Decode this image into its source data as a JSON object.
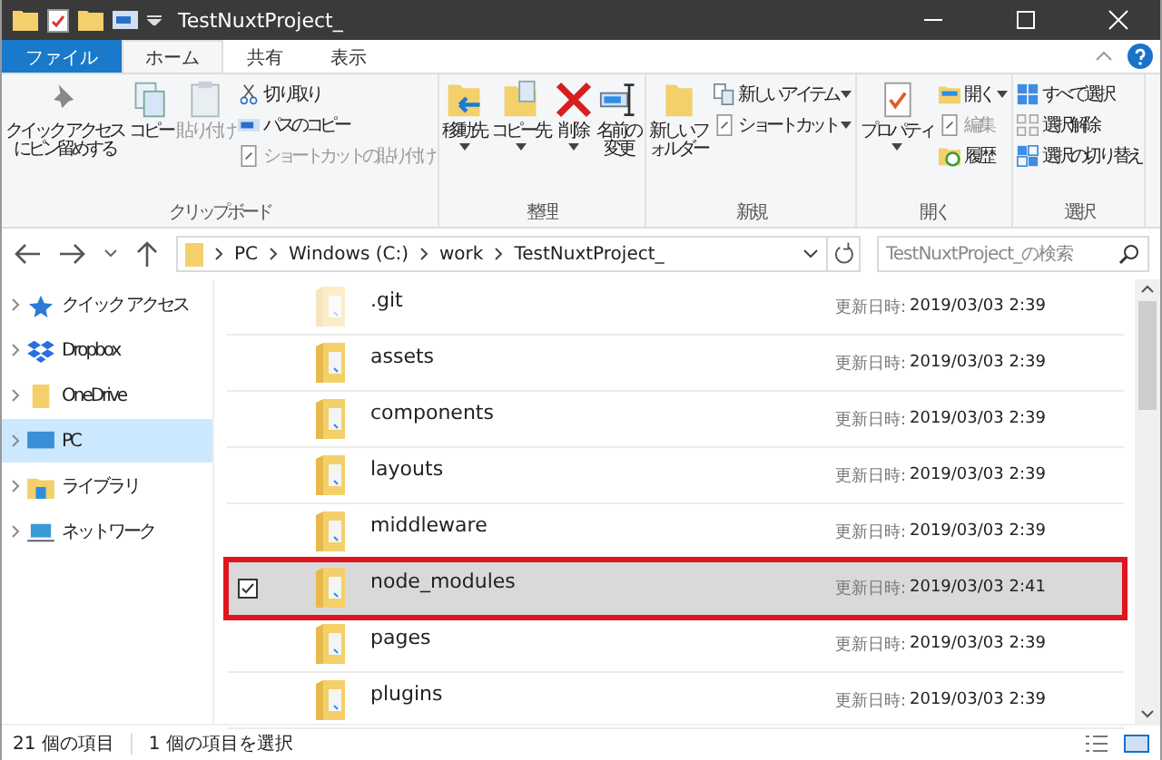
{
  "window": {
    "title": "TestNuxtProject_"
  },
  "tabs": [
    {
      "label": "ファイル",
      "kind": "file",
      "selected": false
    },
    {
      "label": "ホーム",
      "kind": "tab",
      "selected": true
    },
    {
      "label": "共有",
      "kind": "tab",
      "selected": false
    },
    {
      "label": "表示",
      "kind": "tab",
      "selected": false
    }
  ],
  "ribbon": [
    {
      "label": "クリップボード",
      "items": [
        {
          "kind": "large",
          "label": "クイック アクセスにピン留めする",
          "disabled": false
        },
        {
          "kind": "large",
          "label": "コピー",
          "disabled": false
        },
        {
          "kind": "large",
          "label": "貼り付け",
          "disabled": true
        },
        {
          "kind": "stack",
          "children": [
            {
              "label": "切り取り",
              "disabled": false
            },
            {
              "label": "パスのコピー",
              "disabled": false
            },
            {
              "label": "ショートカットの貼り付け",
              "disabled": true
            }
          ]
        }
      ]
    },
    {
      "label": "整理",
      "items": [
        {
          "kind": "large",
          "label": "移動先",
          "disabled": false,
          "dropdown": true
        },
        {
          "kind": "large",
          "label": "コピー先",
          "disabled": false,
          "dropdown": true
        },
        {
          "kind": "large",
          "label": "削除",
          "disabled": false,
          "dropdown": true
        },
        {
          "kind": "large",
          "label": "名前の変更",
          "disabled": false
        }
      ]
    },
    {
      "label": "新規",
      "items": [
        {
          "kind": "large",
          "label": "新しいフォルダー",
          "disabled": false
        },
        {
          "kind": "stack",
          "children": [
            {
              "label": "新しいアイテム",
              "disabled": false,
              "dropdown": true
            },
            {
              "label": "ショートカット",
              "disabled": false,
              "dropdown": true
            }
          ]
        }
      ]
    },
    {
      "label": "開く",
      "items": [
        {
          "kind": "large",
          "label": "プロパティ",
          "disabled": false,
          "dropdown": true
        },
        {
          "kind": "stack",
          "children": [
            {
              "label": "開く",
              "disabled": false,
              "dropdown": true
            },
            {
              "label": "編集",
              "disabled": true
            },
            {
              "label": "履歴",
              "disabled": false
            }
          ]
        }
      ]
    },
    {
      "label": "選択",
      "items": [
        {
          "kind": "stack",
          "children": [
            {
              "label": "すべて選択",
              "disabled": false
            },
            {
              "label": "選択解除",
              "disabled": false
            },
            {
              "label": "選択の切り替え",
              "disabled": false
            }
          ]
        }
      ]
    }
  ],
  "address": {
    "path": [
      "PC",
      "Windows (C:)",
      "work",
      "TestNuxtProject_"
    ],
    "search_placeholder": "TestNuxtProject_の検索"
  },
  "sidebar": {
    "items": [
      {
        "label": "クイック アクセス",
        "selected": false
      },
      {
        "label": "Dropbox",
        "selected": false
      },
      {
        "label": "OneDrive",
        "selected": false
      },
      {
        "label": "PC",
        "selected": true
      },
      {
        "label": "ライブラリ",
        "selected": false
      },
      {
        "label": "ネットワーク",
        "selected": false
      }
    ]
  },
  "files": [
    {
      "name": ".git",
      "date_label": "更新日時:",
      "date": "2019/03/03 2:39",
      "selected": false,
      "checked": false,
      "highlighted": false,
      "hidden": true
    },
    {
      "name": "assets",
      "date_label": "更新日時:",
      "date": "2019/03/03 2:39",
      "selected": false,
      "checked": false,
      "highlighted": false,
      "hidden": false
    },
    {
      "name": "components",
      "date_label": "更新日時:",
      "date": "2019/03/03 2:39",
      "selected": false,
      "checked": false,
      "highlighted": false,
      "hidden": false
    },
    {
      "name": "layouts",
      "date_label": "更新日時:",
      "date": "2019/03/03 2:39",
      "selected": false,
      "checked": false,
      "highlighted": false,
      "hidden": false
    },
    {
      "name": "middleware",
      "date_label": "更新日時:",
      "date": "2019/03/03 2:39",
      "selected": false,
      "checked": false,
      "highlighted": false,
      "hidden": false
    },
    {
      "name": "node_modules",
      "date_label": "更新日時:",
      "date": "2019/03/03 2:41",
      "selected": true,
      "checked": true,
      "highlighted": true,
      "hidden": false
    },
    {
      "name": "pages",
      "date_label": "更新日時:",
      "date": "2019/03/03 2:39",
      "selected": false,
      "checked": false,
      "highlighted": false,
      "hidden": false
    },
    {
      "name": "plugins",
      "date_label": "更新日時:",
      "date": "2019/03/03 2:39",
      "selected": false,
      "checked": false,
      "highlighted": false,
      "hidden": false
    }
  ],
  "status_bar": {
    "item_count": "21 個の項目",
    "selection": "1 個の項目を選択"
  }
}
